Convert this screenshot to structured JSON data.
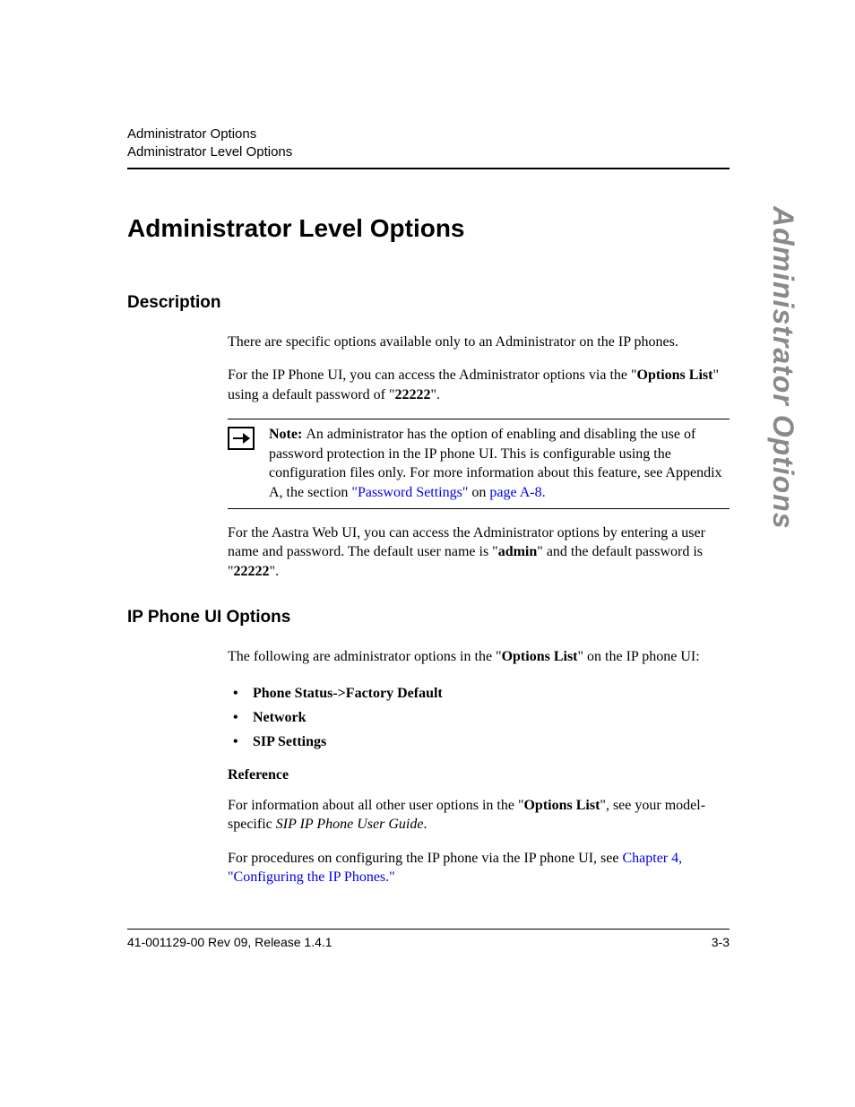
{
  "header": {
    "line1": "Administrator Options",
    "line2": "Administrator Level Options"
  },
  "side_tab": "Administrator Options",
  "title": "Administrator Level Options",
  "sections": {
    "description": {
      "heading": "Description",
      "p1": "There are specific options available only to an Administrator on the IP phones.",
      "p2_a": "For the IP Phone UI, you can access the Administrator options via the \"",
      "p2_b": "Options List",
      "p2_c": "\" using a default password of \"",
      "p2_d": "22222",
      "p2_e": "\".",
      "note_label": "Note: ",
      "note_a": "An administrator has the option of enabling and disabling the use of password protection in the IP phone UI. This is configurable using the configuration files only. For more information about this feature, see Appendix A, the section ",
      "note_link1": "\"Password Settings\"",
      "note_mid": " on ",
      "note_link2": "page A-8.",
      "p3_a": "For the Aastra Web UI, you can access the Administrator options by entering a user name and password. The default user name is \"",
      "p3_b": "admin",
      "p3_c": "\" and the default password is \"",
      "p3_d": "22222",
      "p3_e": "\"."
    },
    "ipui": {
      "heading": "IP Phone UI Options",
      "intro_a": "The following are administrator options in the \"",
      "intro_b": "Options List",
      "intro_c": "\" on the IP phone UI:",
      "items": [
        "Phone Status->Factory Default",
        "Network",
        "SIP Settings"
      ],
      "ref_head": "Reference",
      "ref1_a": "For information about all other user options in the \"",
      "ref1_b": "Options List",
      "ref1_c": "\", see your model-specific ",
      "ref1_d": "SIP IP Phone User Guide",
      "ref1_e": ".",
      "ref2_a": "For procedures on configuring the IP phone via the IP phone UI, see ",
      "ref2_link": "Chapter 4, \"Configuring the IP Phones.\""
    }
  },
  "footer": {
    "left": "41-001129-00 Rev 09, Release 1.4.1",
    "right": "3-3"
  }
}
